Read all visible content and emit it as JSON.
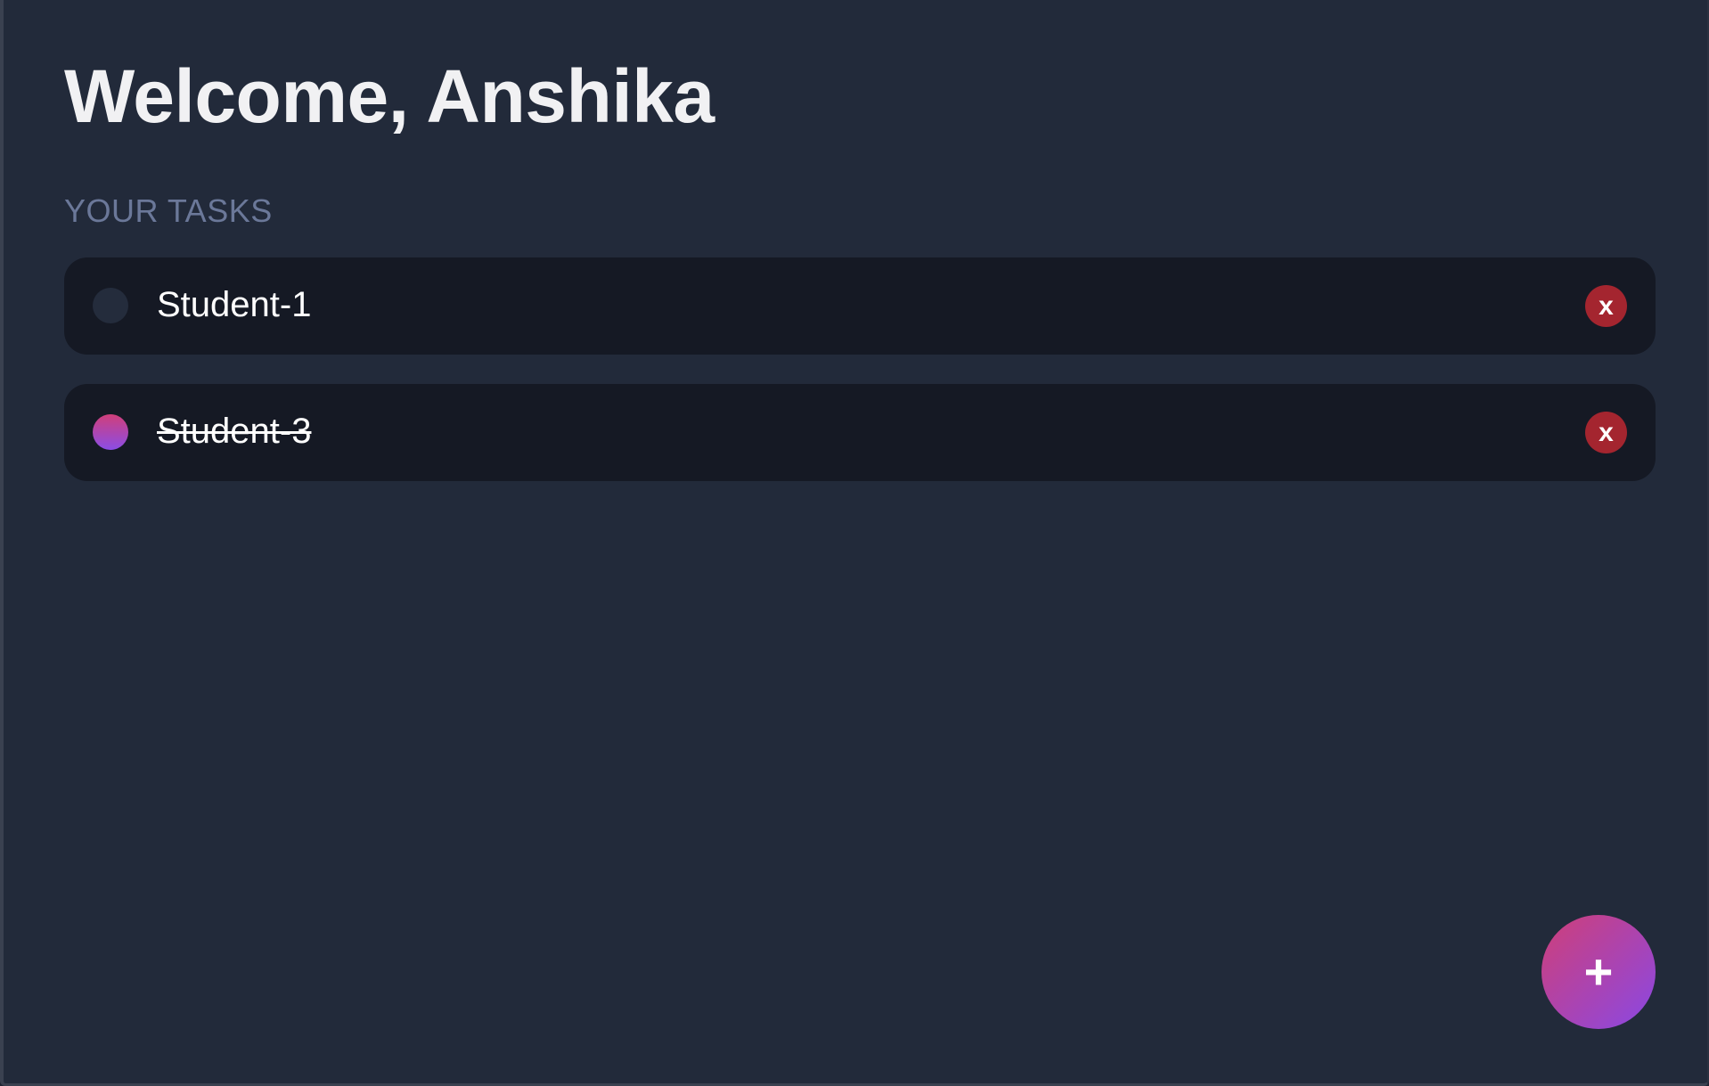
{
  "header": {
    "title": "Welcome, Anshika"
  },
  "tasks_section": {
    "label": "YOUR TASKS",
    "items": [
      {
        "text": "Student-1",
        "completed": false,
        "delete_label": "x"
      },
      {
        "text": "Student-3",
        "completed": true,
        "delete_label": "x"
      }
    ]
  },
  "fab": {
    "label": "+",
    "icon": "plus-icon"
  },
  "colors": {
    "background": "#222a3a",
    "card": "#151924",
    "delete": "#a4252f",
    "accent_start": "#cf3f78",
    "accent_end": "#8a48e4",
    "section_label": "#6b7899"
  }
}
